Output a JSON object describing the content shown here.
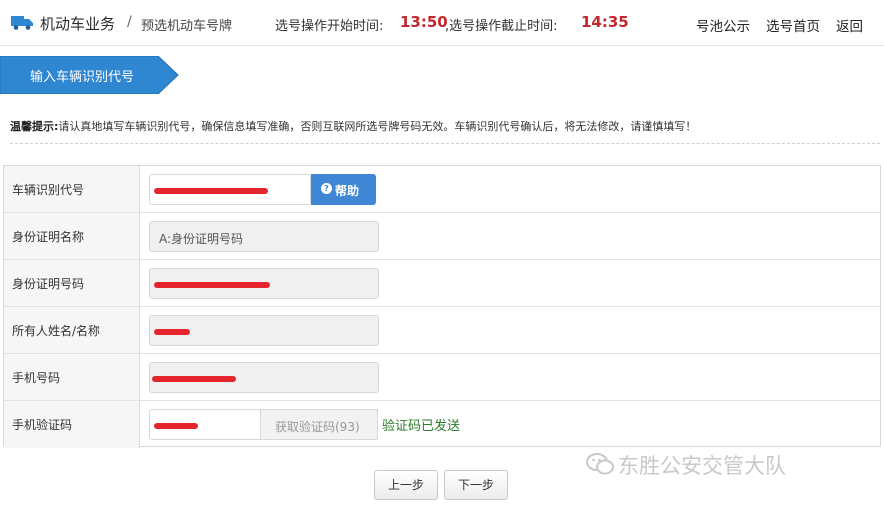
{
  "header": {
    "title": "机动车业务",
    "breadcrumb_sep": "/",
    "breadcrumb": "预选机动车号牌",
    "start_label": "选号操作开始时间:",
    "start_time": "13:50",
    "end_label": ",选号操作截止时间:",
    "end_time": "14:35",
    "nav": [
      "号池公示",
      "选号首页",
      "返回"
    ]
  },
  "step": {
    "label": "输入车辆识别代号"
  },
  "tip": {
    "title": "温馨提示:",
    "text": "请认真地填写车辆识别代号，确保信息填写准确，否则互联网所选号牌号码无效。车辆识别代号确认后，将无法修改，请谨慎填写！"
  },
  "form": {
    "vin_label": "车辆识别代号",
    "help_button": "帮助",
    "id_type_label": "身份证明名称",
    "id_type_value": "A:身份证明号码",
    "id_number_label": "身份证明号码",
    "owner_label": "所有人姓名/名称",
    "phone_label": "手机号码",
    "sms_code_label": "手机验证码",
    "get_code_button": "获取验证码(93)",
    "code_sent": "验证码已发送"
  },
  "buttons": {
    "prev": "上一步",
    "next": "下一步"
  },
  "watermark": "东胜公安交管大队",
  "colors": {
    "accent": "#3f86d4",
    "time": "#c2272d",
    "banner": "#2f86d1",
    "sent": "#2c7a2c",
    "redaction": "#e5252d"
  }
}
